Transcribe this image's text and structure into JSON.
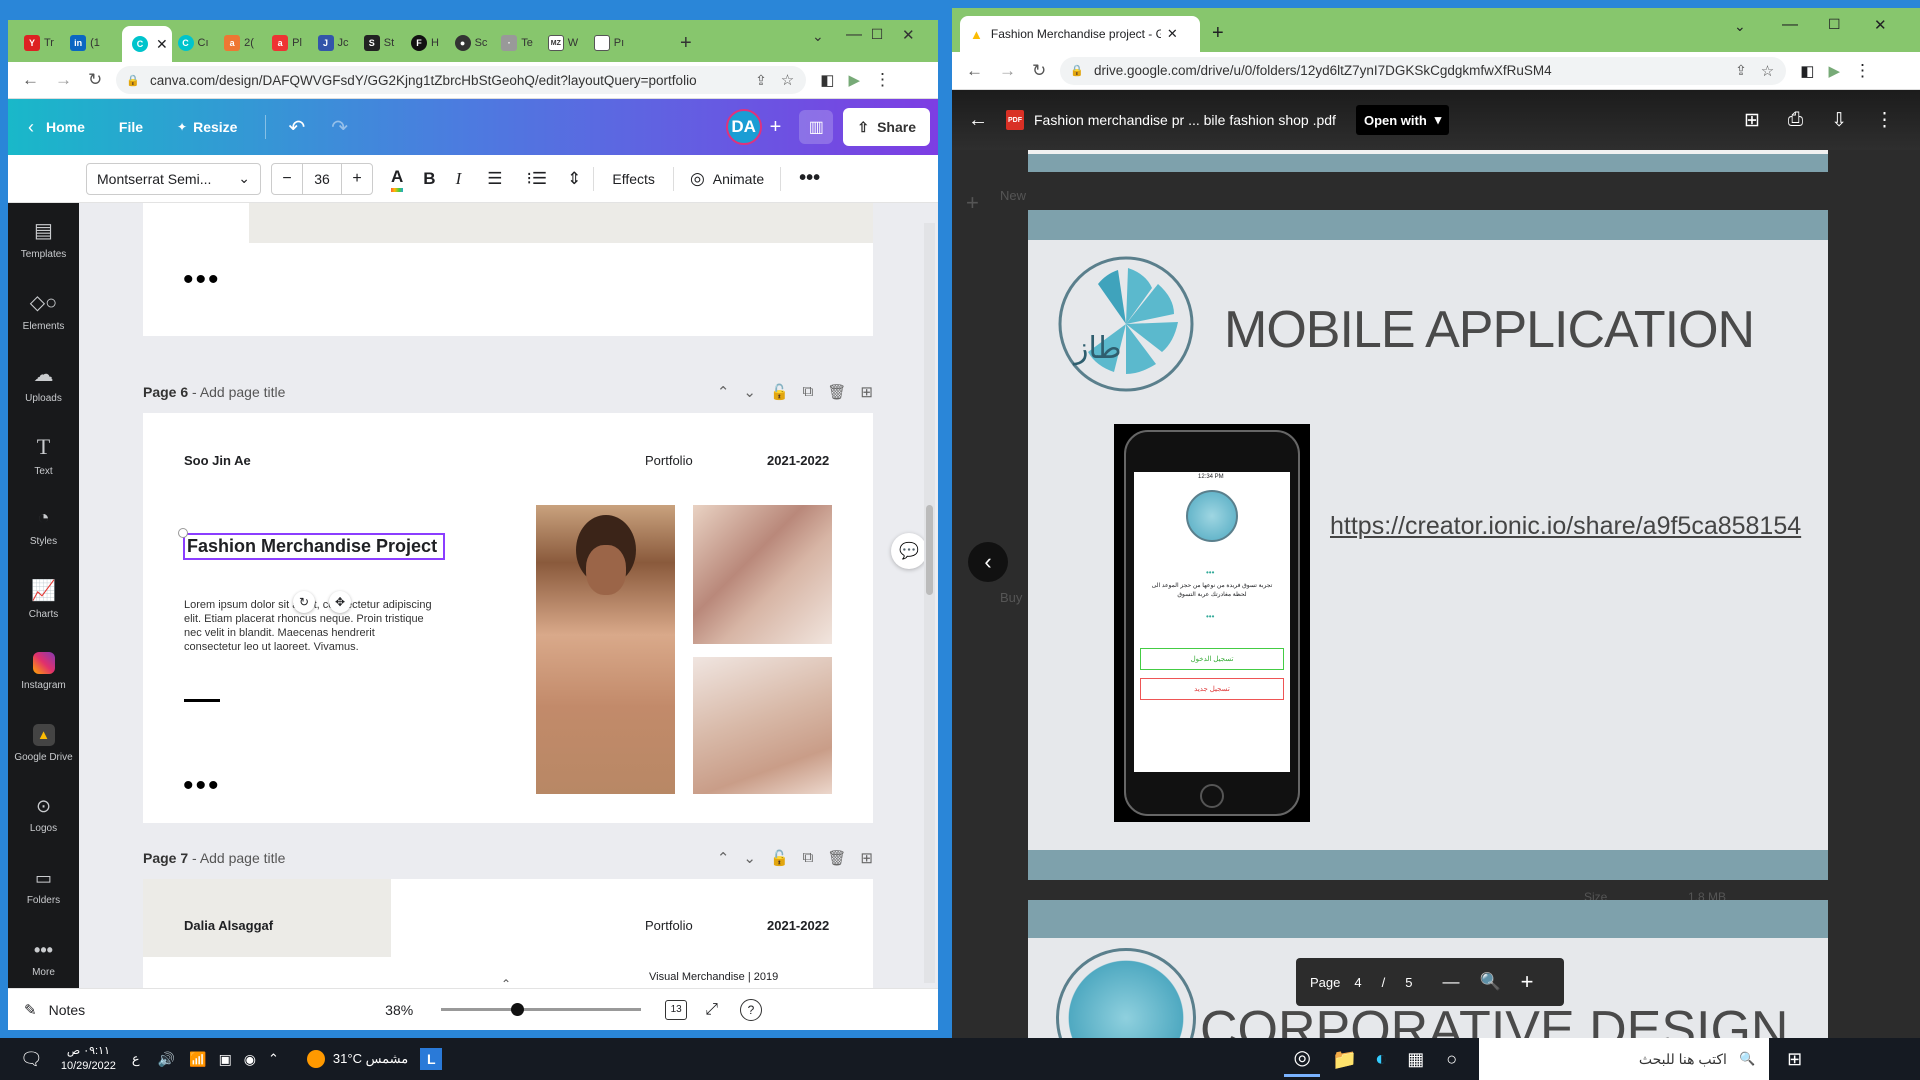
{
  "left_window": {
    "tabs": [
      "Tr",
      "(1",
      "",
      "Cı",
      "2(",
      "Pl",
      "Jc",
      "St",
      "H",
      "Sc",
      "Te",
      "W",
      "Pı"
    ],
    "url": "canva.com/design/DAFQWVGFsdY/GG2Kjng1tZbrcHbStGeohQ/edit?layoutQuery=portfolio",
    "menu": {
      "home": "Home",
      "file": "File",
      "resize": "Resize",
      "avatar": "DA",
      "share": "Share"
    },
    "toolbar": {
      "font": "Montserrat Semi...",
      "font_size": "36",
      "effects": "Effects",
      "animate": "Animate"
    },
    "rail": [
      "Templates",
      "Elements",
      "Uploads",
      "Text",
      "Styles",
      "Charts",
      "Instagram",
      "Google Drive",
      "Logos",
      "Folders",
      "More"
    ],
    "page6": {
      "label": "Page 6",
      "title_placeholder": "Add page title",
      "name": "Soo Jin Ae",
      "portfolio": "Portfolio",
      "years": "2021-2022",
      "heading": "Fashion Merchandise Project",
      "body": "Lorem ipsum dolor sit amet, consectetur adipiscing elit. Etiam placerat rhoncus neque. Proin tristique nec velit in blandit. Maecenas hendrerit consectetur leo ut laoreet. Vivamus."
    },
    "page7": {
      "label": "Page 7",
      "title_placeholder": "Add page title",
      "name": "Dalia Alsaggaf",
      "portfolio": "Portfolio",
      "years": "2021-2022",
      "subtitle": "Visual Merchandise |  2019"
    },
    "bottom": {
      "notes": "Notes",
      "zoom": "38%",
      "pages": "13",
      "zoom_fraction": 0.38
    }
  },
  "right_window": {
    "tab_title": "Fashion Merchandise project - G",
    "url": "drive.google.com/drive/u/0/folders/12yd6ltZ7ynI7DGKSkCgdgkmfwXfRuSM4",
    "file_name": "Fashion merchandise pr ... bile fashion shop .pdf",
    "open_with": "Open with",
    "slide_title": "MOBILE APPLICATION",
    "link": "https://creator.ionic.io/share/a9f5ca858154",
    "next_title": "CORPORATIVE DESIGN",
    "phone": {
      "time": "12:34 PM",
      "text1": "تجربة تسوق فريدة من نوعها من حجز الموعد الى",
      "text2": "لحظة مغادرتك عربة التسوق",
      "btn1": "تسجيل الدخول",
      "btn2": "تسجيل جديد"
    },
    "pager": {
      "label": "Page",
      "current": "4",
      "sep": "/",
      "total": "5"
    },
    "side_texts": [
      "New",
      "Buy",
      "Size",
      "1.8 MB"
    ]
  },
  "taskbar": {
    "time": "٠٩:١١ ص",
    "date": "10/29/2022",
    "lang": "ع",
    "weather": "31°C  مشمس",
    "search": "اكتب هنا للبحث"
  },
  "colors": {
    "canva_grad_start": "#19b8c9",
    "canva_grad_end": "#7d3de3",
    "chrome_green": "#87c66d",
    "rail": "#18191b",
    "heading_selection": "#8b3dff"
  }
}
